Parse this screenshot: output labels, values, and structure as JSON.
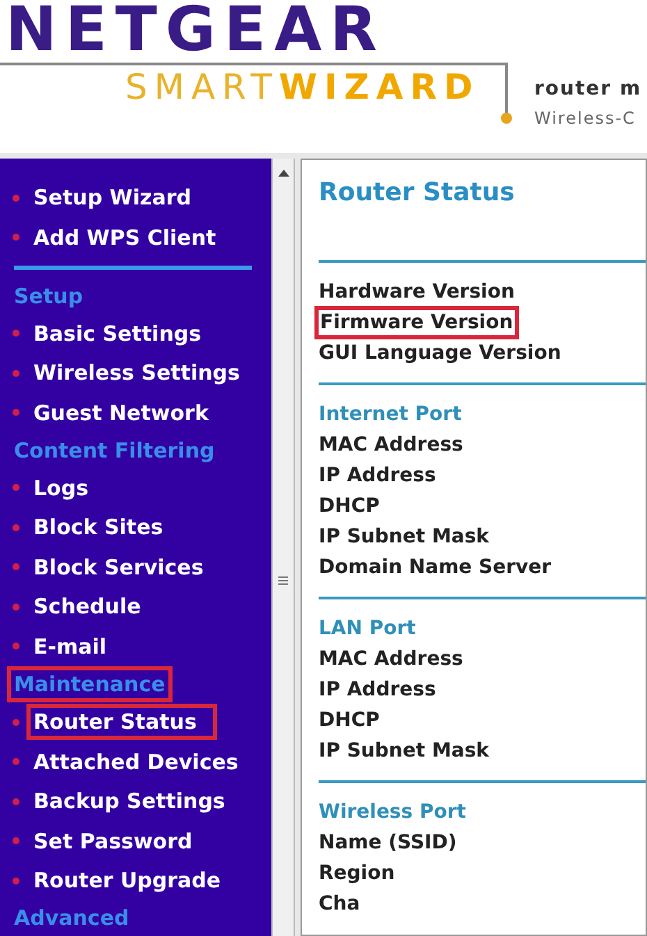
{
  "header": {
    "brand": "NETGEAR",
    "product": [
      {
        "text": "SMART",
        "bold": false
      },
      {
        "text": "WIZARD",
        "bold": true
      }
    ],
    "tagline": "router m",
    "subtitle": "Wireless-C"
  },
  "sidebar": {
    "items": [
      {
        "kind": "link",
        "label": "Setup Wizard",
        "highlighted": false
      },
      {
        "kind": "link",
        "label": "Add WPS Client",
        "highlighted": false
      },
      {
        "kind": "rule"
      },
      {
        "kind": "heading",
        "label": "Setup",
        "highlighted": false
      },
      {
        "kind": "link",
        "label": "Basic Settings",
        "highlighted": false
      },
      {
        "kind": "link",
        "label": "Wireless Settings",
        "highlighted": false
      },
      {
        "kind": "link",
        "label": "Guest Network",
        "highlighted": false
      },
      {
        "kind": "heading",
        "label": "Content Filtering",
        "highlighted": false
      },
      {
        "kind": "link",
        "label": "Logs",
        "highlighted": false
      },
      {
        "kind": "link",
        "label": "Block Sites",
        "highlighted": false
      },
      {
        "kind": "link",
        "label": "Block Services",
        "highlighted": false
      },
      {
        "kind": "link",
        "label": "Schedule",
        "highlighted": false
      },
      {
        "kind": "link",
        "label": "E-mail",
        "highlighted": false
      },
      {
        "kind": "heading",
        "label": "Maintenance",
        "highlighted": true
      },
      {
        "kind": "link",
        "label": "Router Status",
        "highlighted": true
      },
      {
        "kind": "link",
        "label": "Attached Devices",
        "highlighted": false
      },
      {
        "kind": "link",
        "label": "Backup Settings",
        "highlighted": false
      },
      {
        "kind": "link",
        "label": "Set Password",
        "highlighted": false
      },
      {
        "kind": "link",
        "label": "Router Upgrade",
        "highlighted": false
      },
      {
        "kind": "heading",
        "label": "Advanced",
        "highlighted": false
      }
    ]
  },
  "main": {
    "title": "Router Status",
    "sections": [
      {
        "fields": [
          {
            "label": "Hardware Version",
            "highlighted": false
          },
          {
            "label": "Firmware Version",
            "highlighted": true
          },
          {
            "label": "GUI Language Version",
            "highlighted": false
          }
        ]
      },
      {
        "heading": "Internet Port",
        "fields": [
          {
            "label": "MAC Address",
            "highlighted": false
          },
          {
            "label": "IP Address",
            "highlighted": false
          },
          {
            "label": "DHCP",
            "highlighted": false
          },
          {
            "label": "IP Subnet Mask",
            "highlighted": false
          },
          {
            "label": "Domain Name Server",
            "highlighted": false
          }
        ]
      },
      {
        "heading": "LAN Port",
        "fields": [
          {
            "label": "MAC Address",
            "highlighted": false
          },
          {
            "label": "IP Address",
            "highlighted": false
          },
          {
            "label": "DHCP",
            "highlighted": false
          },
          {
            "label": "IP Subnet Mask",
            "highlighted": false
          }
        ]
      },
      {
        "heading": "Wireless Port",
        "fields": [
          {
            "label": "Name (SSID)",
            "highlighted": false
          },
          {
            "label": "Region",
            "highlighted": false
          },
          {
            "label": "Cha",
            "highlighted": false
          }
        ]
      }
    ]
  }
}
